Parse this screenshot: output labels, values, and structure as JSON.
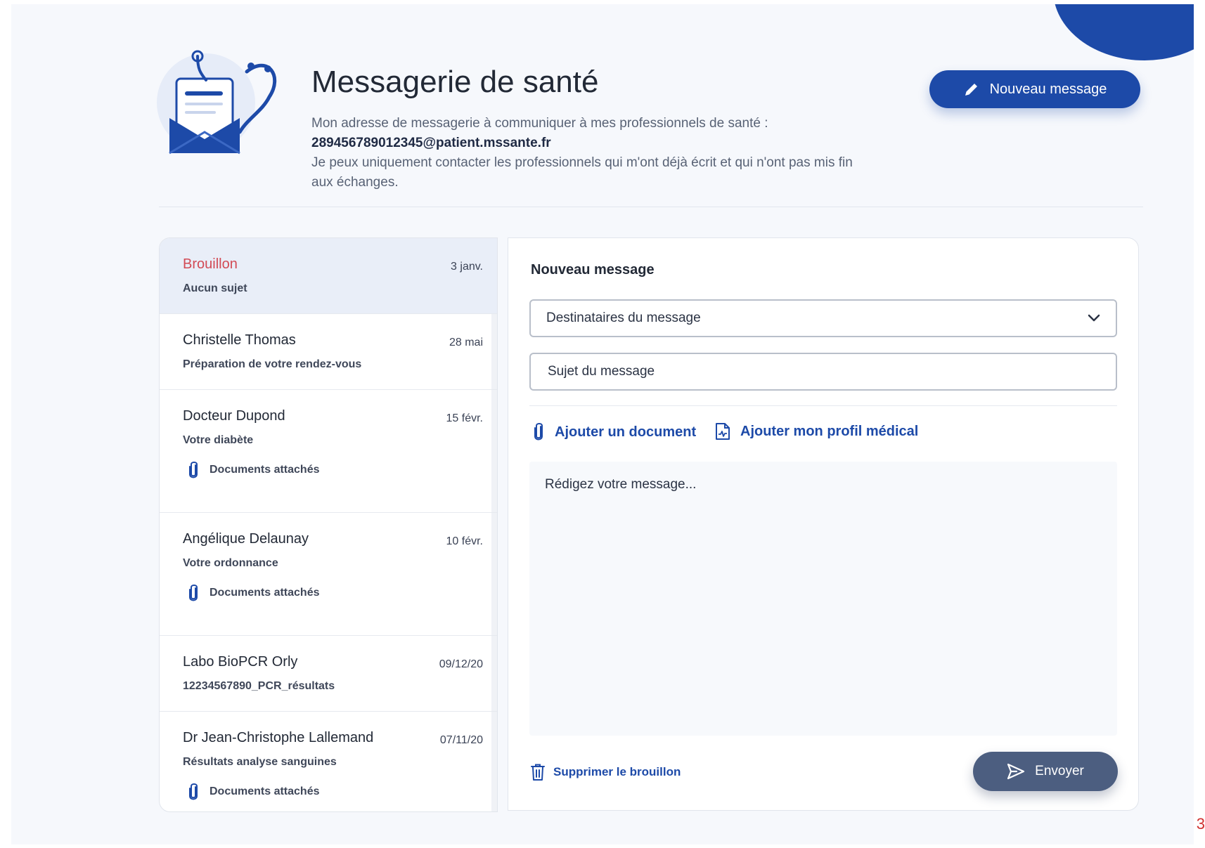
{
  "page": {
    "title": "Messagerie de santé",
    "intro_line1": "Mon adresse de messagerie à communiquer à mes professionnels de santé :",
    "email": "289456789012345@patient.mssante.fr",
    "intro_line2": "Je peux uniquement contacter les professionnels qui m'ont déjà écrit et qui n'ont pas mis fin aux échanges.",
    "new_message_button": "Nouveau message",
    "page_number": "3"
  },
  "colors": {
    "primary": "#1d4aa8",
    "draft": "#d24a55",
    "send_button": "#4c5e80",
    "active_row": "#e9eef8"
  },
  "messages": [
    {
      "name": "Brouillon",
      "date": "3 janv.",
      "subject": "Aucun sujet",
      "attachments": "",
      "active": true
    },
    {
      "name": "Christelle Thomas",
      "date": "28 mai",
      "subject": "Préparation de votre rendez-vous",
      "attachments": ""
    },
    {
      "name": "Docteur Dupond",
      "date": "15 févr.",
      "subject": "Votre diabète",
      "attachments": "Documents attachés"
    },
    {
      "name": "Angélique Delaunay",
      "date": "10 févr.",
      "subject": "Votre ordonnance",
      "attachments": "Documents attachés"
    },
    {
      "name": "Labo BioPCR Orly",
      "date": "09/12/20",
      "subject": "12234567890_PCR_résultats",
      "attachments": ""
    },
    {
      "name": "Dr Jean-Christophe Lallemand",
      "date": "07/11/20",
      "subject": "Résultats analyse sanguines",
      "attachments": "Documents attachés"
    }
  ],
  "compose": {
    "title": "Nouveau message",
    "recipients_placeholder": "Destinataires du message",
    "subject_placeholder": "Sujet du message",
    "add_document": "Ajouter un document",
    "add_medical_profile": "Ajouter mon profil médical",
    "body_placeholder": "Rédigez votre message...",
    "delete_draft": "Supprimer le brouillon",
    "send": "Envoyer"
  },
  "icons": {
    "header_illustration": "mail-stethoscope-illustration",
    "new_message": "pencil-icon",
    "attachment": "paperclip-icon",
    "medical_profile": "medical-document-icon",
    "dropdown": "chevron-down-icon",
    "delete": "trash-icon",
    "send": "send-icon"
  }
}
